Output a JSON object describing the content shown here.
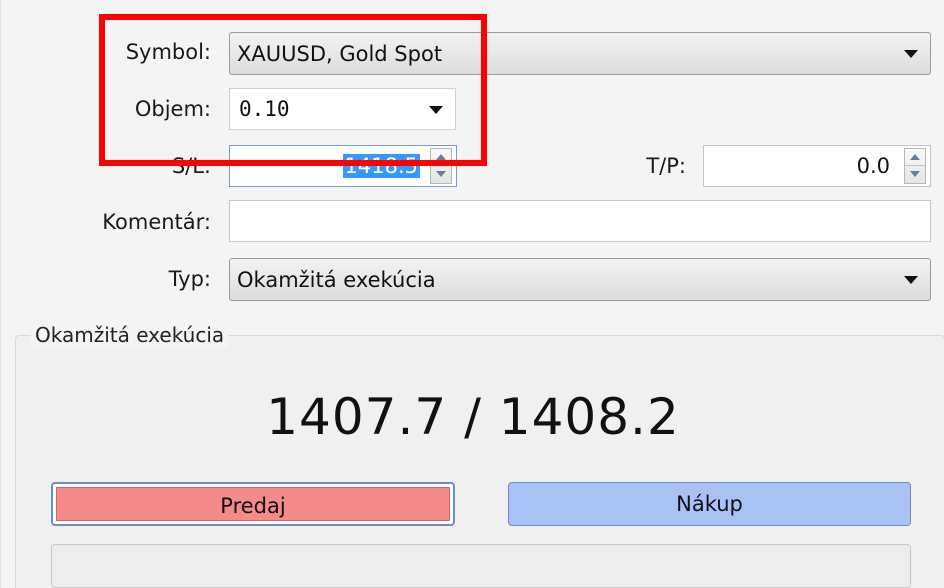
{
  "form": {
    "symbol_label": "Symbol:",
    "symbol_value": "XAUUSD, Gold Spot",
    "volume_label": "Objem:",
    "volume_value": "0.10",
    "sl_label": "S/L:",
    "sl_value": "1418.5",
    "tp_label": "T/P:",
    "tp_value": "0.0",
    "comment_label": "Komentár:",
    "comment_value": "",
    "type_label": "Typ:",
    "type_value": "Okamžitá exekúcia"
  },
  "execution": {
    "title": "Okamžitá exekúcia",
    "price": "1407.7 / 1408.2",
    "sell_label": "Predaj",
    "buy_label": "Nákup"
  },
  "colors": {
    "sell": "#f58a8a",
    "buy": "#a8c2f5",
    "highlight": "#ff0000",
    "selection": "#3399ff"
  },
  "icons": {
    "dropdown": "chevron-down-icon",
    "spinner_up": "arrow-up-icon",
    "spinner_down": "arrow-down-icon"
  }
}
